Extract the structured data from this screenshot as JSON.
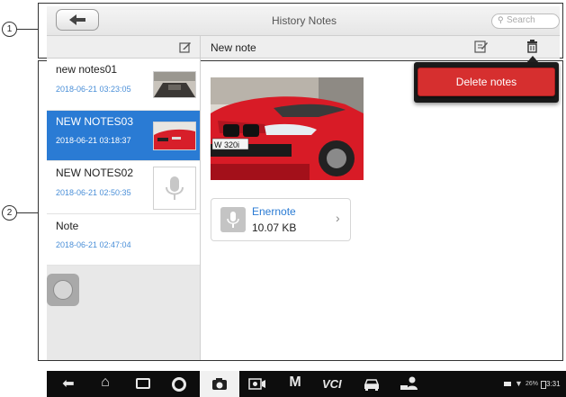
{
  "callouts": {
    "one": "1",
    "two": "2"
  },
  "header": {
    "title": "History Notes",
    "search_placeholder": "Search"
  },
  "subheader": {
    "note_title": "New note"
  },
  "notes": [
    {
      "title": "new notes01",
      "date": "2018-06-21 03:23:05",
      "selected": false
    },
    {
      "title": "NEW NOTES03",
      "date": "2018-06-21 03:18:37",
      "selected": true
    },
    {
      "title": "NEW NOTES02",
      "date": "2018-06-21 02:50:35",
      "selected": false
    },
    {
      "title": "Note",
      "date": "2018-06-21 02:47:04",
      "selected": false
    }
  ],
  "popup": {
    "delete_label": "Delete notes"
  },
  "attachment": {
    "name": "Enernote",
    "size": "10.07 KB"
  },
  "car_plate": "W 320i",
  "statusbar": {
    "battery": "26%",
    "time": "3:31"
  },
  "icons": [
    "back-arrow-icon",
    "home-icon",
    "recent-apps-icon",
    "browser-icon",
    "camera-icon",
    "screen-record-icon",
    "maxi-icon",
    "vci-icon",
    "car-icon",
    "technician-icon"
  ]
}
